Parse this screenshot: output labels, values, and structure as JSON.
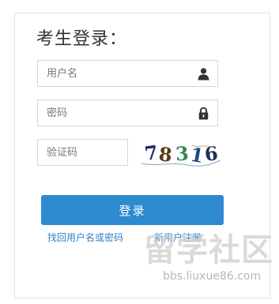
{
  "login": {
    "title": "考生登录：",
    "username_placeholder": "用户名",
    "password_placeholder": "密码",
    "captcha_placeholder": "验证码",
    "captcha_chars": [
      "7",
      "8",
      "3",
      "1",
      "6"
    ],
    "captcha_colors": [
      "#1e2a66",
      "#5a3a15",
      "#2f8a55",
      "#1c4b87",
      "#20305a"
    ],
    "submit_label": "登录",
    "forgot_link": "找回用户名或密码",
    "register_link": "新用户注册",
    "icons": {
      "username": "user-icon",
      "password": "lock-icon"
    }
  },
  "watermark": {
    "logo_text": "留学社区",
    "url_text": "bbs.liuxue86.com"
  },
  "colors": {
    "accent": "#2f8bd0",
    "link": "#2f7fc8",
    "border": "#d6d6d6"
  }
}
